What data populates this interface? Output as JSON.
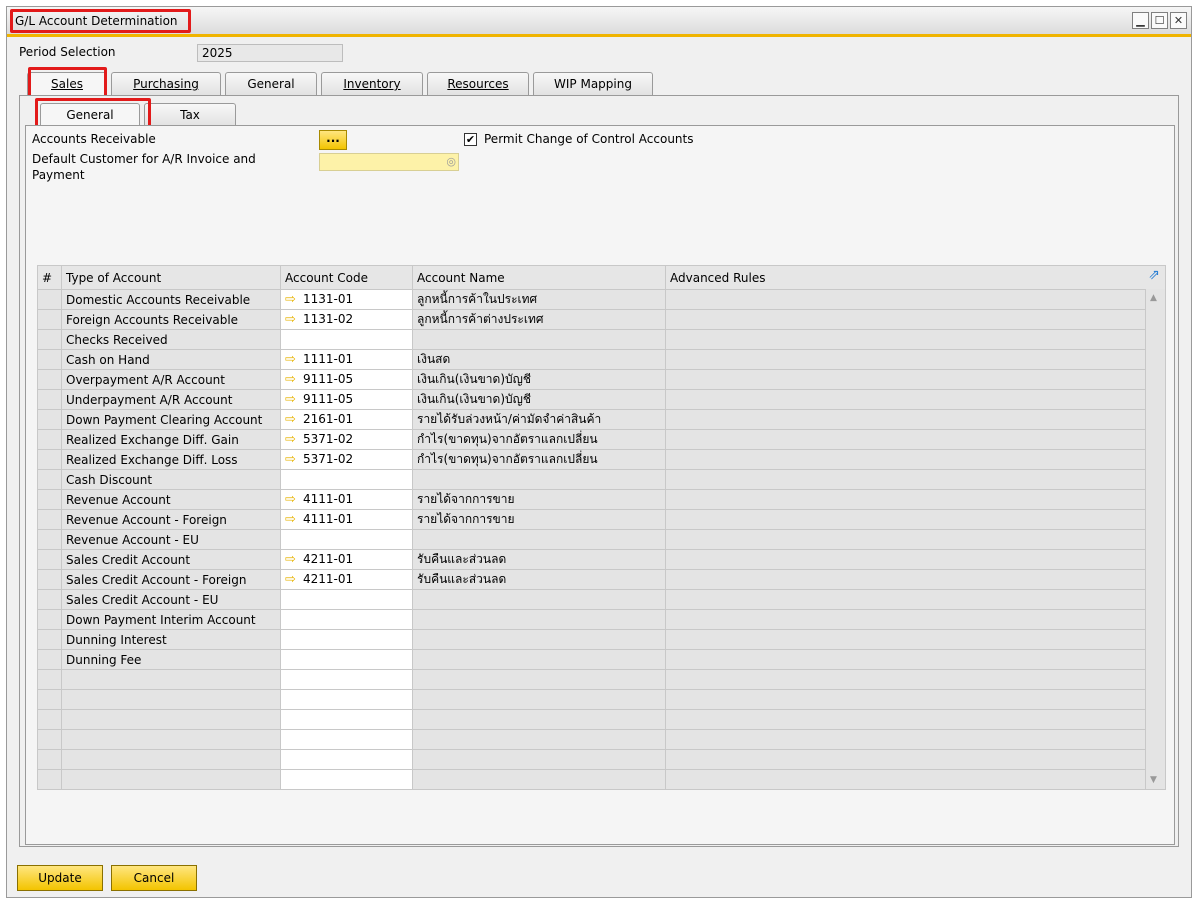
{
  "window": {
    "title": "G/L Account Determination",
    "buttons": {
      "minimize": "▁",
      "maximize": "☐",
      "close": "✕"
    }
  },
  "period": {
    "label": "Period Selection",
    "value": "2025"
  },
  "tabs": [
    "Sales",
    "Purchasing",
    "General",
    "Inventory",
    "Resources",
    "WIP Mapping"
  ],
  "subtabs": [
    "General",
    "Tax"
  ],
  "form": {
    "accounts_receivable_label": "Accounts Receivable",
    "browse_label": "...",
    "permit_change_label": "Permit Change of Control Accounts",
    "default_customer_label_line1": "Default Customer for A/R Invoice and",
    "default_customer_label_line2": "Payment"
  },
  "grid": {
    "columns": [
      "#",
      "Type of Account",
      "Account Code",
      "Account Name",
      "Advanced Rules"
    ],
    "rows": [
      {
        "type": "Domestic Accounts Receivable",
        "code": "1131-01",
        "name": "ลูกหนี้การค้าในประเทศ"
      },
      {
        "type": "Foreign Accounts Receivable",
        "code": "1131-02",
        "name": "ลูกหนี้การค้าต่างประเทศ"
      },
      {
        "type": "Checks Received",
        "code": "",
        "name": ""
      },
      {
        "type": "Cash on Hand",
        "code": "1111-01",
        "name": "เงินสด"
      },
      {
        "type": "Overpayment A/R Account",
        "code": "9111-05",
        "name": "เงินเกิน(เงินขาด)บัญชี"
      },
      {
        "type": "Underpayment A/R Account",
        "code": "9111-05",
        "name": "เงินเกิน(เงินขาด)บัญชี"
      },
      {
        "type": "Down Payment Clearing Account",
        "code": "2161-01",
        "name": "รายได้รับล่วงหน้า/ค่ามัดจำค่าสินค้า"
      },
      {
        "type": "Realized Exchange Diff. Gain",
        "code": "5371-02",
        "name": "กำไร(ขาดทุน)จากอัตราแลกเปลี่ยน"
      },
      {
        "type": "Realized Exchange Diff. Loss",
        "code": "5371-02",
        "name": "กำไร(ขาดทุน)จากอัตราแลกเปลี่ยน"
      },
      {
        "type": "Cash Discount",
        "code": "",
        "name": ""
      },
      {
        "type": "Revenue Account",
        "code": "4111-01",
        "name": "รายได้จากการขาย"
      },
      {
        "type": "Revenue Account - Foreign",
        "code": "4111-01",
        "name": "รายได้จากการขาย"
      },
      {
        "type": "Revenue Account - EU",
        "code": "",
        "name": ""
      },
      {
        "type": "Sales Credit Account",
        "code": "4211-01",
        "name": "รับคืนและส่วนลด"
      },
      {
        "type": "Sales Credit Account - Foreign",
        "code": "4211-01",
        "name": "รับคืนและส่วนลด"
      },
      {
        "type": "Sales Credit Account - EU",
        "code": "",
        "name": ""
      },
      {
        "type": "Down Payment Interim Account",
        "code": "",
        "name": ""
      },
      {
        "type": "Dunning Interest",
        "code": "",
        "name": ""
      },
      {
        "type": "Dunning Fee",
        "code": "",
        "name": ""
      },
      {
        "type": "",
        "code": "",
        "name": ""
      },
      {
        "type": "",
        "code": "",
        "name": ""
      },
      {
        "type": "",
        "code": "",
        "name": ""
      },
      {
        "type": "",
        "code": "",
        "name": ""
      },
      {
        "type": "",
        "code": "",
        "name": ""
      },
      {
        "type": "",
        "code": "",
        "name": ""
      }
    ]
  },
  "buttons": {
    "update": "Update",
    "cancel": "Cancel"
  },
  "colors": {
    "accent": "#f0b400",
    "highlight": "#e21a1a",
    "field_yellow": "#fdf2a8"
  }
}
